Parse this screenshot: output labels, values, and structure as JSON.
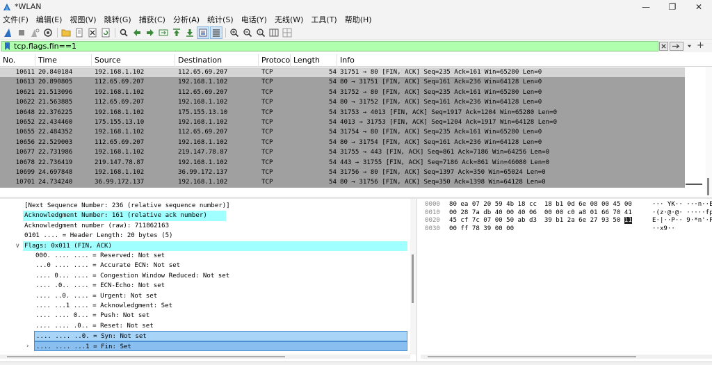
{
  "window": {
    "title": "*WLAN",
    "minimize": "—",
    "maximize": "❐",
    "close": "✕"
  },
  "menu": [
    "文件(F)",
    "编辑(E)",
    "视图(V)",
    "跳转(G)",
    "捕获(C)",
    "分析(A)",
    "统计(S)",
    "电话(Y)",
    "无线(W)",
    "工具(T)",
    "帮助(H)"
  ],
  "filter": {
    "value": "tcp.flags.fin==1"
  },
  "columns": {
    "no": "No.",
    "time": "Time",
    "source": "Source",
    "destination": "Destination",
    "protocol": "Protoco",
    "length": "Length",
    "info": "Info"
  },
  "packets": [
    {
      "no": "10611",
      "time": "20.840184",
      "src": "192.168.1.102",
      "dst": "112.65.69.207",
      "proto": "TCP",
      "len": "54",
      "info": "31751 → 80 [FIN, ACK] Seq=235 Ack=161 Win=65280 Len=0"
    },
    {
      "no": "10613",
      "time": "20.890805",
      "src": "112.65.69.207",
      "dst": "192.168.1.102",
      "proto": "TCP",
      "len": "54",
      "info": "80 → 31751 [FIN, ACK] Seq=161 Ack=236 Win=64128 Len=0"
    },
    {
      "no": "10621",
      "time": "21.513096",
      "src": "192.168.1.102",
      "dst": "112.65.69.207",
      "proto": "TCP",
      "len": "54",
      "info": "31752 → 80 [FIN, ACK] Seq=235 Ack=161 Win=65280 Len=0"
    },
    {
      "no": "10622",
      "time": "21.563885",
      "src": "112.65.69.207",
      "dst": "192.168.1.102",
      "proto": "TCP",
      "len": "54",
      "info": "80 → 31752 [FIN, ACK] Seq=161 Ack=236 Win=64128 Len=0"
    },
    {
      "no": "10648",
      "time": "22.376225",
      "src": "192.168.1.102",
      "dst": "175.155.13.10",
      "proto": "TCP",
      "len": "54",
      "info": "31753 → 4013 [FIN, ACK] Seq=1917 Ack=1204 Win=65280 Len=0"
    },
    {
      "no": "10652",
      "time": "22.434460",
      "src": "175.155.13.10",
      "dst": "192.168.1.102",
      "proto": "TCP",
      "len": "54",
      "info": "4013 → 31753 [FIN, ACK] Seq=1204 Ack=1917 Win=64128 Len=0"
    },
    {
      "no": "10655",
      "time": "22.484352",
      "src": "192.168.1.102",
      "dst": "112.65.69.207",
      "proto": "TCP",
      "len": "54",
      "info": "31754 → 80 [FIN, ACK] Seq=235 Ack=161 Win=65280 Len=0"
    },
    {
      "no": "10656",
      "time": "22.529003",
      "src": "112.65.69.207",
      "dst": "192.168.1.102",
      "proto": "TCP",
      "len": "54",
      "info": "80 → 31754 [FIN, ACK] Seq=161 Ack=236 Win=64128 Len=0"
    },
    {
      "no": "10677",
      "time": "22.731986",
      "src": "192.168.1.102",
      "dst": "219.147.78.87",
      "proto": "TCP",
      "len": "54",
      "info": "31755 → 443 [FIN, ACK] Seq=861 Ack=7186 Win=64256 Len=0"
    },
    {
      "no": "10678",
      "time": "22.736419",
      "src": "219.147.78.87",
      "dst": "192.168.1.102",
      "proto": "TCP",
      "len": "54",
      "info": "443 → 31755 [FIN, ACK] Seq=7186 Ack=861 Win=46080 Len=0"
    },
    {
      "no": "10699",
      "time": "24.697848",
      "src": "192.168.1.102",
      "dst": "36.99.172.137",
      "proto": "TCP",
      "len": "54",
      "info": "31756 → 80 [FIN, ACK] Seq=1397 Ack=350 Win=65024 Len=0"
    },
    {
      "no": "10701",
      "time": "24.734240",
      "src": "36.99.172.137",
      "dst": "192.168.1.102",
      "proto": "TCP",
      "len": "54",
      "info": "80 → 31756 [FIN, ACK] Seq=350 Ack=1398 Win=64128 Len=0"
    }
  ],
  "details": [
    {
      "text": "[Next Sequence Number: 236    (relative sequence number)]",
      "indent": 35,
      "style": ""
    },
    {
      "text": "Acknowledgment Number: 161    (relative ack number)",
      "indent": 35,
      "style": "hl-cyan"
    },
    {
      "text": "Acknowledgment number (raw): 711862163",
      "indent": 35,
      "style": ""
    },
    {
      "text": "0101 .... = Header Length: 20 bytes (5)",
      "indent": 35,
      "style": ""
    },
    {
      "text": "Flags: 0x011 (FIN, ACK)",
      "indent": 35,
      "style": "hl-cyan",
      "expander": "∨"
    },
    {
      "text": "000. .... .... = Reserved: Not set",
      "indent": 51,
      "style": ""
    },
    {
      "text": "...0 .... .... = Accurate ECN: Not set",
      "indent": 51,
      "style": ""
    },
    {
      "text": ".... 0... .... = Congestion Window Reduced: Not set",
      "indent": 51,
      "style": ""
    },
    {
      "text": ".... .0.. .... = ECN-Echo: Not set",
      "indent": 51,
      "style": ""
    },
    {
      "text": ".... ..0. .... = Urgent: Not set",
      "indent": 51,
      "style": ""
    },
    {
      "text": ".... ...1 .... = Acknowledgment: Set",
      "indent": 51,
      "style": ""
    },
    {
      "text": ".... .... 0... = Push: Not set",
      "indent": 51,
      "style": ""
    },
    {
      "text": ".... .... .0.. = Reset: Not set",
      "indent": 51,
      "style": ""
    },
    {
      "text": ".... .... ..0. = Syn: Not set",
      "indent": 51,
      "style": "hl-blue"
    },
    {
      "text": ".... .... ...1 = Fin: Set",
      "indent": 51,
      "style": "hl-blue2",
      "expander": "›"
    }
  ],
  "bytes": [
    {
      "offset": "0000",
      "hex": "80 ea 07 20 59 4b 18 cc  18 b1 0d 6e 08 00 45 00",
      "ascii": "··· YK·· ···n··E·"
    },
    {
      "offset": "0010",
      "hex": "00 28 7a db 40 00 40 06  00 00 c0 a8 01 66 70 41",
      "ascii": "·(z·@·@· ·····fpA"
    },
    {
      "offset": "0020",
      "hex_pre": "45 cf 7c 07 00 50 ab d3  39 b1 2a 6e 27 93 50 ",
      "hex_hl": "11",
      "ascii": "E·|··P·· 9·*n'·P·"
    },
    {
      "offset": "0030",
      "hex": "00 ff 78 39 00 00",
      "ascii": "··x9··"
    }
  ]
}
